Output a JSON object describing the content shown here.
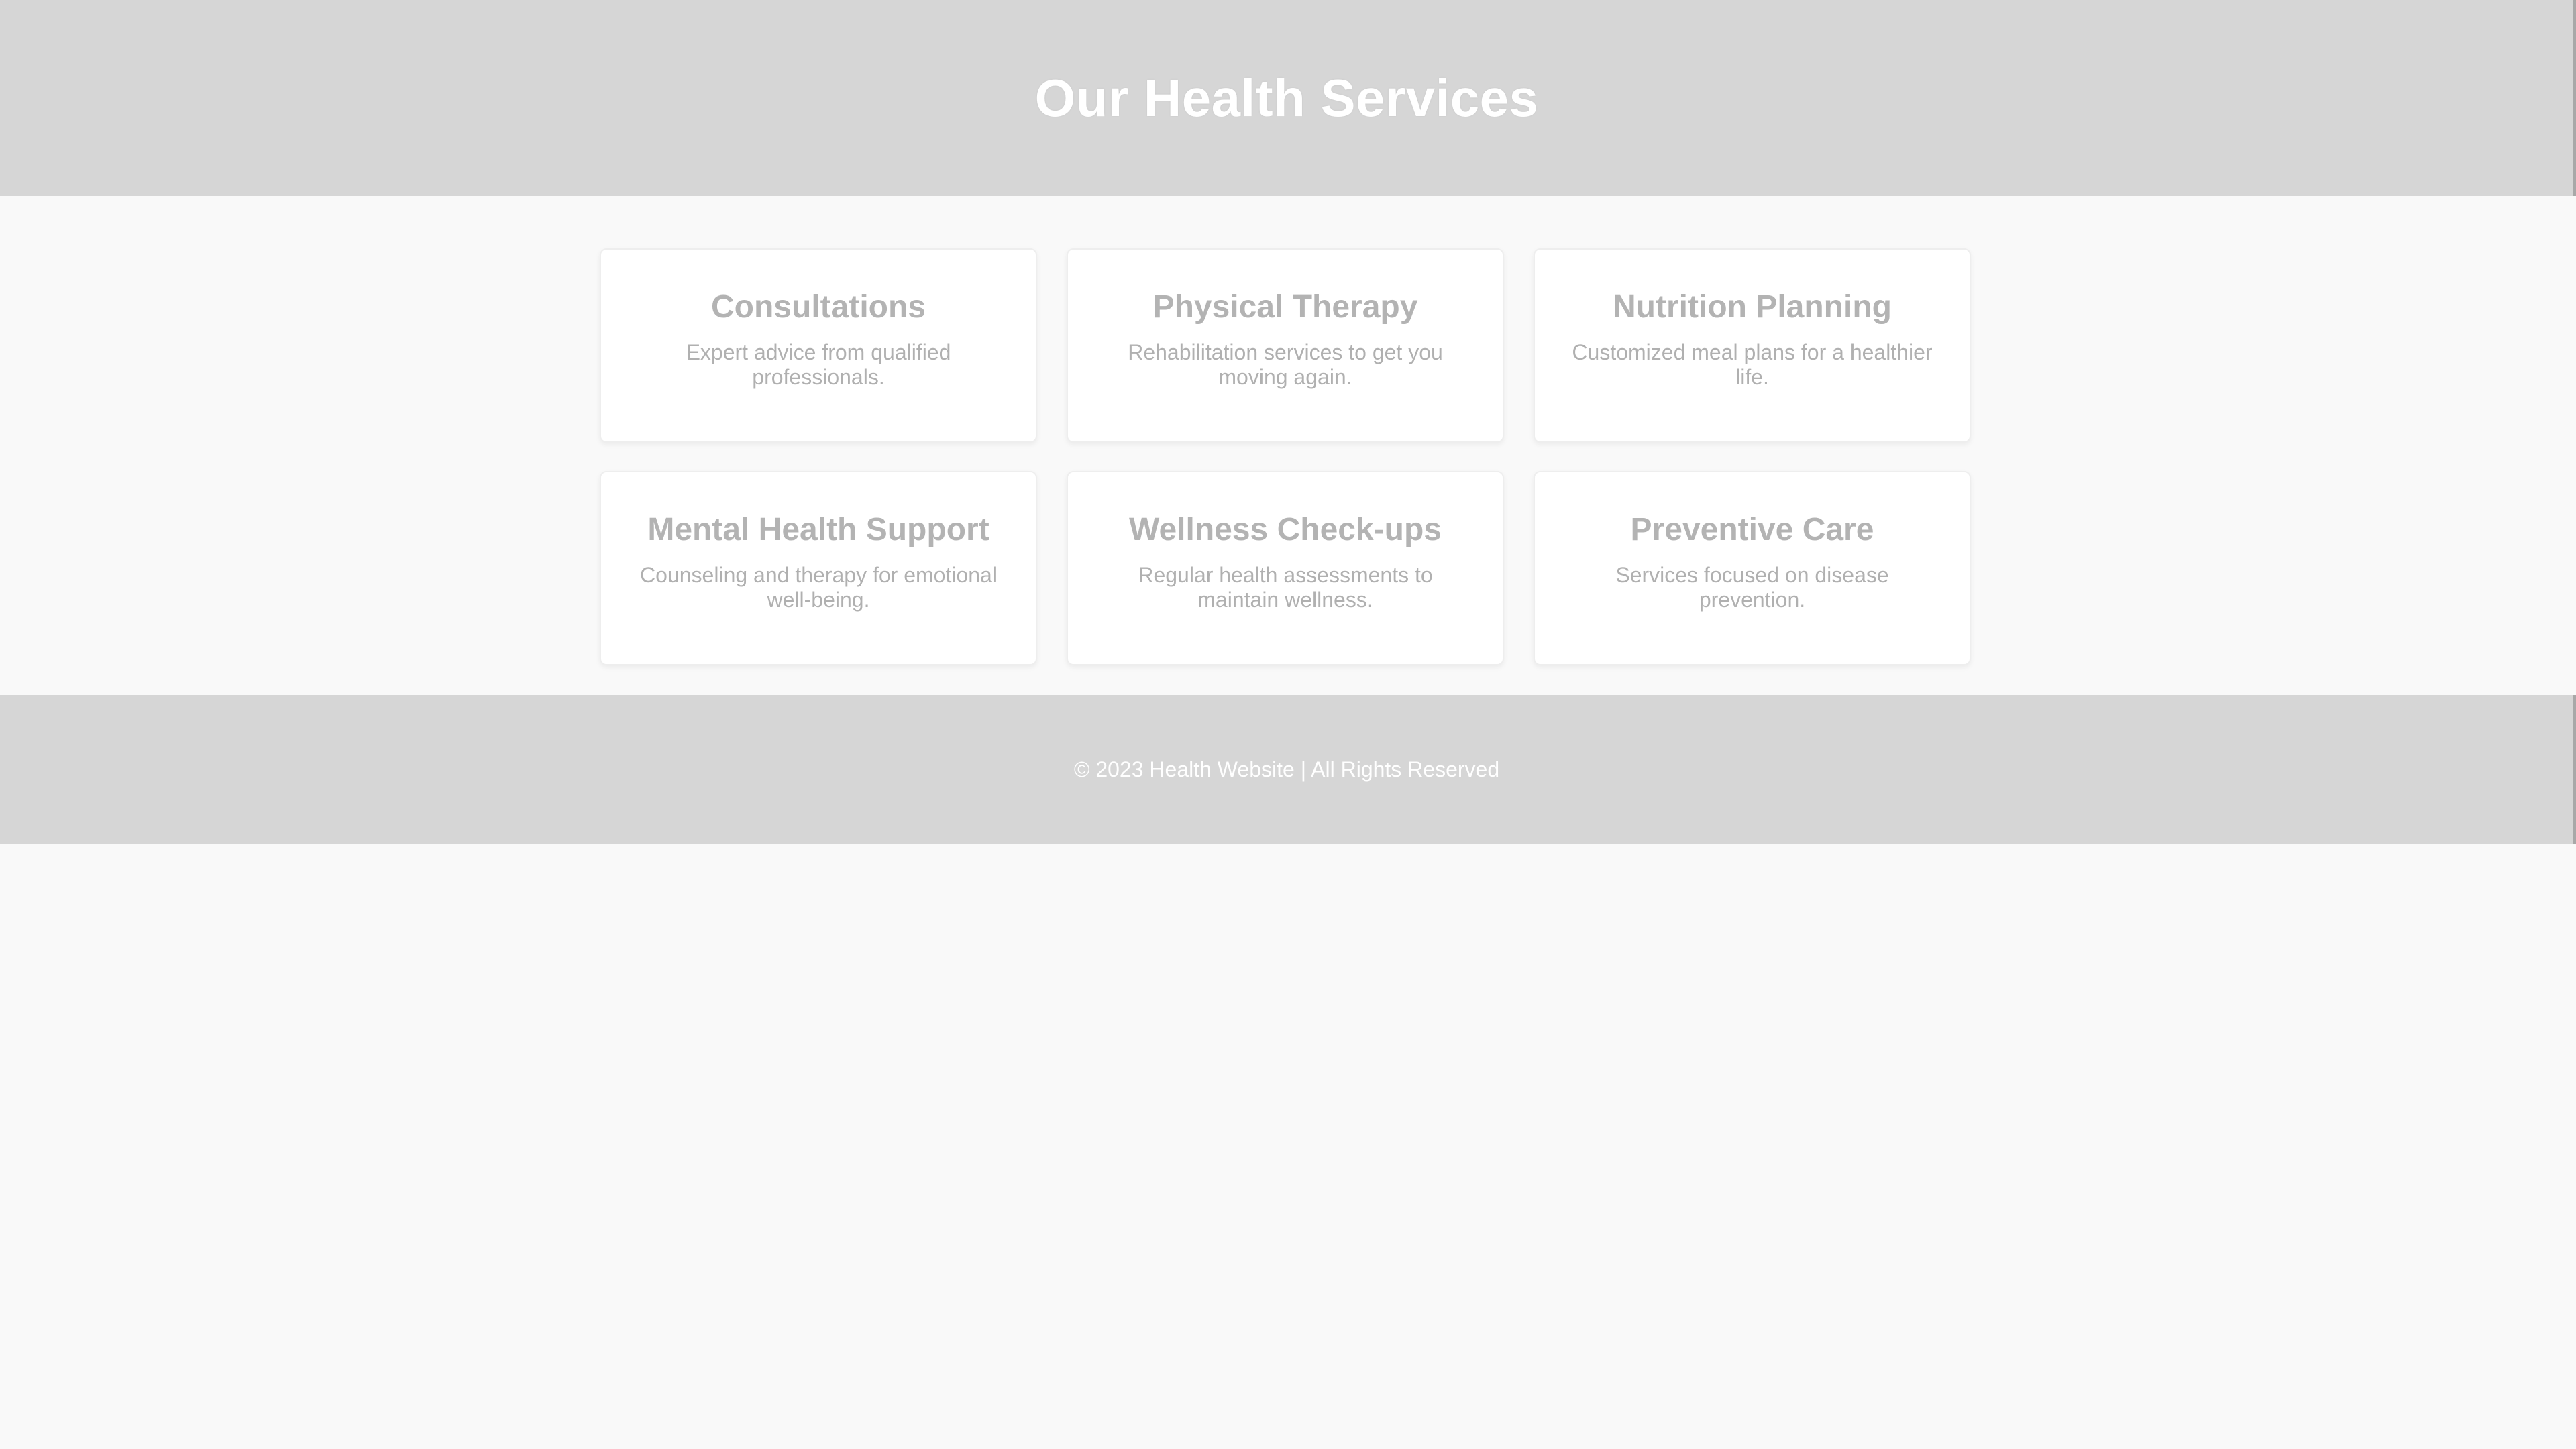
{
  "header": {
    "title": "Our Health Services"
  },
  "services": [
    {
      "title": "Consultations",
      "description": "Expert advice from qualified professionals."
    },
    {
      "title": "Physical Therapy",
      "description": "Rehabilitation services to get you moving again."
    },
    {
      "title": "Nutrition Planning",
      "description": "Customized meal plans for a healthier life."
    },
    {
      "title": "Mental Health Support",
      "description": "Counseling and therapy for emotional well-being."
    },
    {
      "title": "Wellness Check-ups",
      "description": "Regular health assessments to maintain wellness."
    },
    {
      "title": "Preventive Care",
      "description": "Services focused on disease prevention."
    }
  ],
  "footer": {
    "text": "© 2023 Health Website | All Rights Reserved"
  },
  "colors": {
    "header_bg": "#d6d6d6",
    "page_bg": "#f9f9f9",
    "card_bg": "#ffffff",
    "card_text": "#b3b3b3",
    "header_text": "#ffffff"
  }
}
